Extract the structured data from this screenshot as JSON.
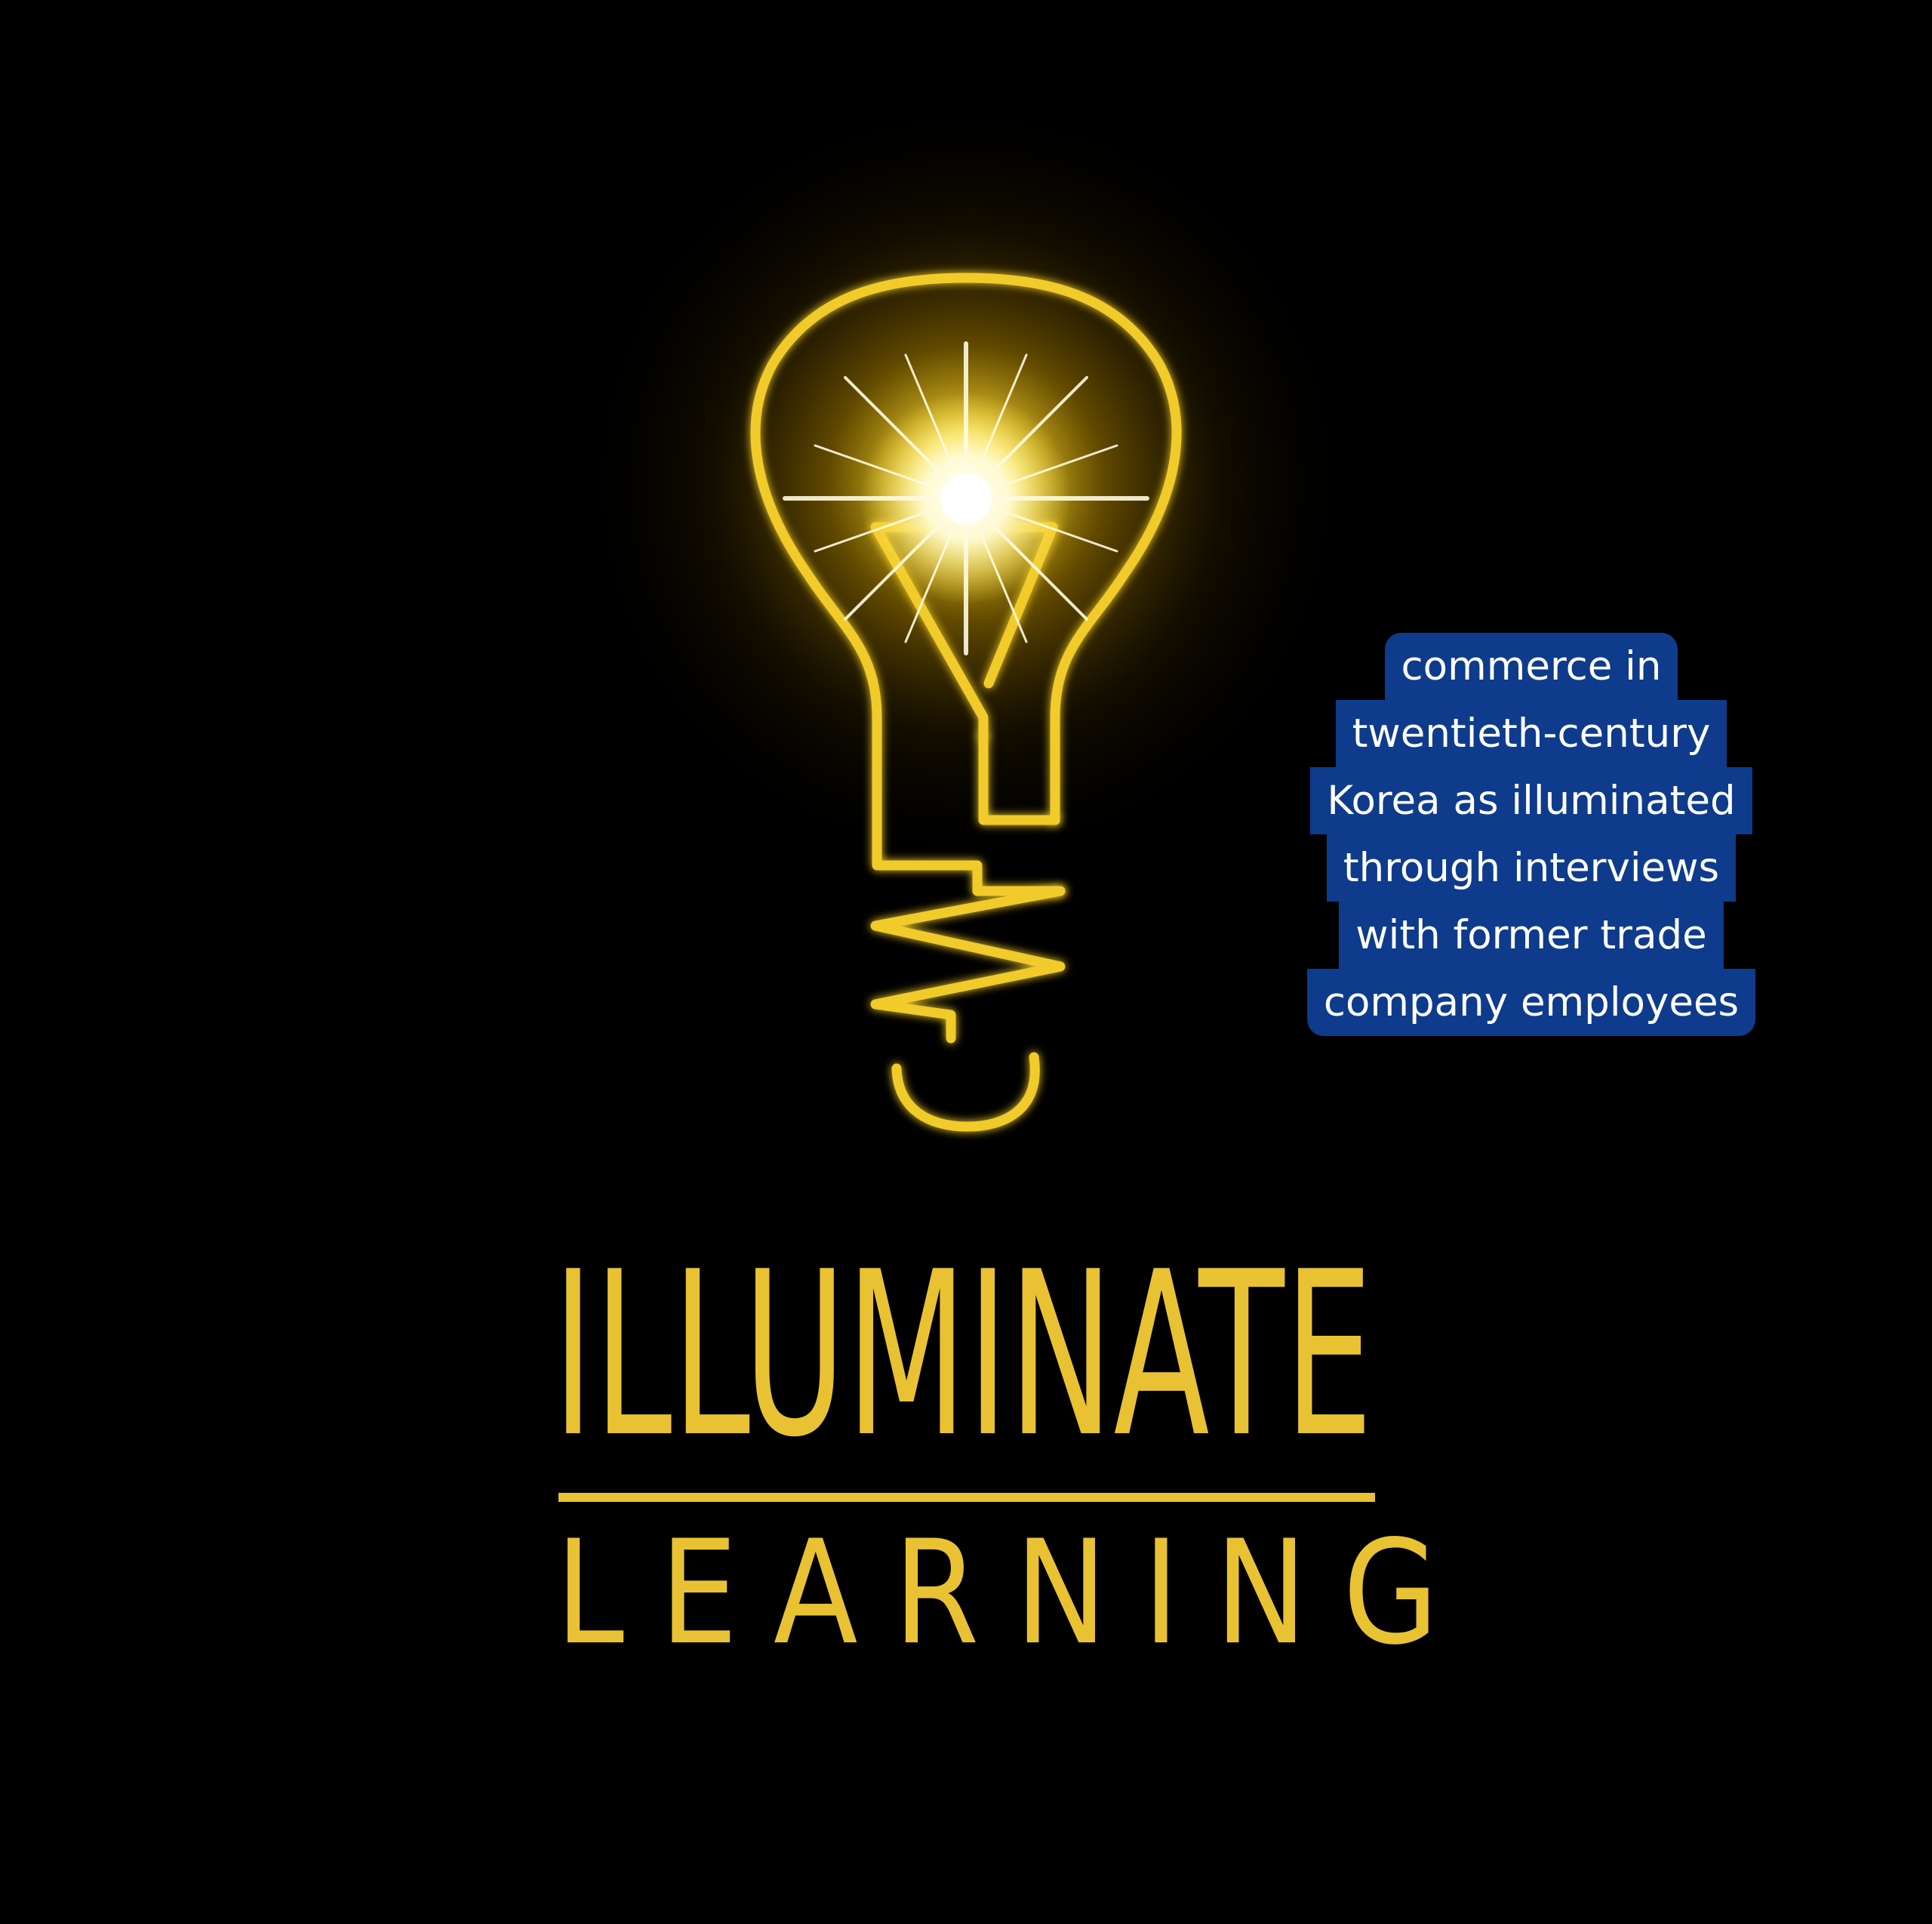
{
  "logo": {
    "line1": "ILLUMINATE",
    "line2": "LEARNING"
  },
  "caption": {
    "lines": [
      "commerce in",
      "twentieth-century",
      "Korea as illuminated",
      "through interviews",
      "with former trade",
      "company employees"
    ]
  },
  "colors": {
    "background": "#000000",
    "gold": "#e8c233",
    "caption_background": "#0e3b8c",
    "caption_text": "#ffffff"
  },
  "icons": {
    "bulb": "lightbulb-icon",
    "spark": "sparkle-icon"
  }
}
